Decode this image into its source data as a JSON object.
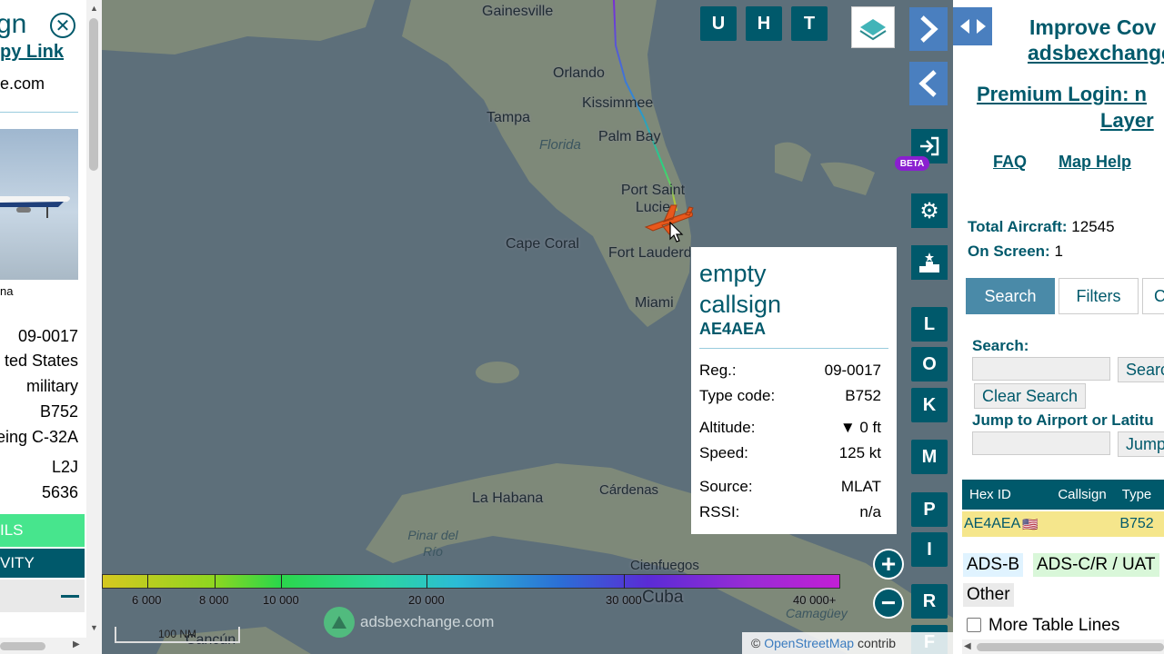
{
  "left_panel": {
    "title_fragment": "gn",
    "copy_link": "py Link",
    "domain_fragment": "e.com",
    "photo_credit_fragment": "na",
    "rows": [
      "09-0017",
      "ted States",
      "military",
      "B752",
      "eing C-32A",
      "L2J",
      "5636"
    ],
    "details_btn": "ILS",
    "activity_btn": "VITY"
  },
  "map": {
    "cities": [
      "Gainesville",
      "Orlando",
      "Kissimmee",
      "Tampa",
      "Florida",
      "Palm Bay",
      "Port Saint Lucie",
      "Cape Coral",
      "Fort Lauderdale",
      "Miami",
      "La Habana",
      "Cárdenas",
      "Pinar del Río",
      "Cienfuegos",
      "Cuba",
      "Camagüey",
      "Cancún"
    ],
    "buttons": {
      "u": "U",
      "h": "H",
      "t": "T",
      "l": "L",
      "o": "O",
      "k": "K",
      "m": "M",
      "p": "P",
      "i": "I",
      "r": "R",
      "f": "F"
    },
    "beta_label": "BETA",
    "altitude_scale": [
      "6 000",
      "8 000",
      "10 000",
      "20 000",
      "30 000",
      "40 000+"
    ],
    "scale_label": "100 NM",
    "watermark": "adsbexchange.com",
    "attribution_prefix": "©",
    "attribution_link": "OpenStreetMap",
    "attribution_suffix": "contrib",
    "colors": {
      "track_start": "#7a2bd6",
      "track_end": "#d6c22b",
      "plane": "#e8581c"
    }
  },
  "popup": {
    "callsign_line1": "empty",
    "callsign_line2": "callsign",
    "hex": "AE4AEA",
    "rows": [
      {
        "label": "Reg.:",
        "value": "09-0017"
      },
      {
        "label": "Type code:",
        "value": "B752"
      },
      {
        "label": "Altitude:",
        "value": "▼ 0 ft"
      },
      {
        "label": "Speed:",
        "value": "125 kt"
      },
      {
        "label": "Source:",
        "value": "MLAT"
      },
      {
        "label": "RSSI:",
        "value": "n/a"
      }
    ]
  },
  "right_panel": {
    "improve1": "Improve Cov",
    "improve2": "adsbexchange",
    "premium1": "Premium Login: n",
    "premium2": "Layer",
    "faq": "FAQ",
    "map_help": "Map Help",
    "total_label": "Total Aircraft:",
    "total_value": "12545",
    "onscreen_label": "On Screen:",
    "onscreen_value": "1",
    "tabs": [
      "Search",
      "Filters",
      "C"
    ],
    "search_label": "Search:",
    "search_btn": "Search",
    "clear_btn": "Clear Search",
    "jump_label": "Jump to Airport or Latitu",
    "jump_btn": "Jump",
    "table_headers": [
      "Hex ID",
      "",
      "Callsign",
      "Type"
    ],
    "table_row": {
      "hex": "AE4AEA",
      "flag": "🇺🇸",
      "callsign": "",
      "type": "B752"
    },
    "legend": [
      "ADS-B",
      "ADS-C/R / UAT",
      "Other"
    ],
    "more_lines": "More Table Lines"
  }
}
